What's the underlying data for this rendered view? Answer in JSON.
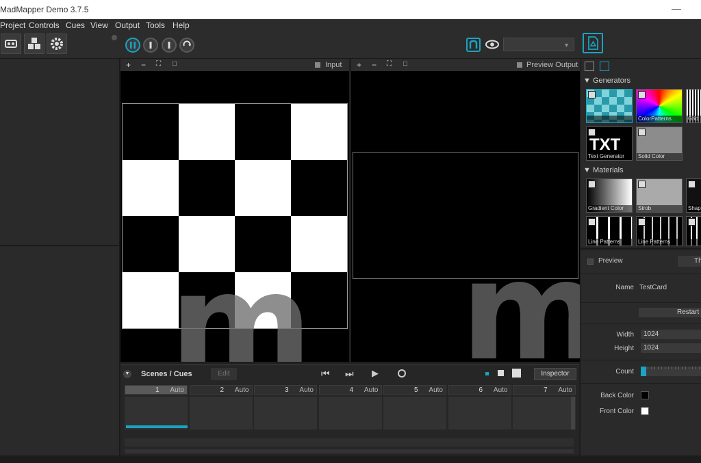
{
  "window": {
    "title": "MadMapper Demo 3.7.5",
    "minimize": "—"
  },
  "menu": [
    "Project",
    "Controls",
    "Cues",
    "View",
    "Output",
    "Tools",
    "Help"
  ],
  "toolbar": {
    "left_icons": [
      "projector-icon",
      "cubes-icon",
      "gear-icon"
    ],
    "transport_icons": [
      "pause-icon",
      "stop-icon",
      "stop-alt-icon",
      "loop-icon"
    ],
    "right_icons": [
      "madmapper-logo-icon",
      "eye-icon"
    ],
    "dropdown_value": "",
    "colors": {
      "accent": "#1aa3c2"
    }
  },
  "input_view": {
    "controls": [
      "+",
      "−",
      "⛶",
      "□"
    ],
    "label": "Input",
    "checker_rows": [
      [
        "black",
        "white",
        "black",
        "white"
      ],
      [
        "white",
        "black",
        "white",
        "black"
      ],
      [
        "black",
        "white",
        "black",
        "white"
      ],
      [
        "white",
        "black",
        "white",
        "black"
      ]
    ]
  },
  "output_view": {
    "controls": [
      "+",
      "−",
      "⛶",
      "□"
    ],
    "label": "Preview Output"
  },
  "scenes": {
    "title": "Scenes / Cues",
    "edit_label": "Edit",
    "inspector_label": "Inspector",
    "cues": [
      {
        "num": "1",
        "mode": "Auto"
      },
      {
        "num": "2",
        "mode": "Auto"
      },
      {
        "num": "3",
        "mode": "Auto"
      },
      {
        "num": "4",
        "mode": "Auto"
      },
      {
        "num": "5",
        "mode": "Auto"
      },
      {
        "num": "6",
        "mode": "Auto"
      },
      {
        "num": "7",
        "mode": "Auto"
      }
    ]
  },
  "library": {
    "generators_title": "Generators",
    "generators": [
      "",
      "ColorPatterns",
      "Grid",
      "Text Generator",
      "Solid Color"
    ],
    "txt_label": "TXT",
    "materials_title": "Materials",
    "materials": [
      "Gradient Color",
      "Strob",
      "Shap",
      "Line Patterns",
      "Line Patterns",
      ""
    ]
  },
  "inspector": {
    "preview_label": "Preview",
    "preview_right": "Th",
    "name_label": "Name",
    "name_value": "TestCard",
    "restart_label": "Restart",
    "width_label": "Width",
    "width_value": "1024",
    "height_label": "Height",
    "height_value": "1024",
    "count_label": "Count",
    "back_color_label": "Back Color",
    "back_color": "#000000",
    "front_color_label": "Front Color",
    "front_color": "#ffffff"
  }
}
